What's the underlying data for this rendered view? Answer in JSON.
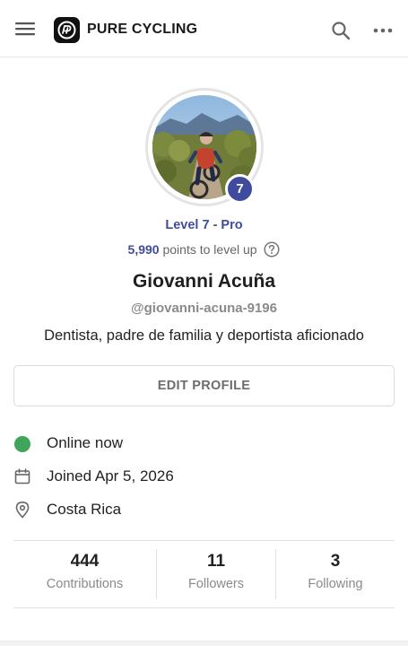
{
  "header": {
    "brand": "PURE CYCLING",
    "icons": [
      "hamburger-menu-icon",
      "pure-cycling-logo-icon",
      "search-icon",
      "more-options-icon"
    ]
  },
  "profile": {
    "level_badge": "7",
    "level_label": "Level 7 - Pro",
    "points": "5,990",
    "points_suffix": "points to level up",
    "name": "Giovanni Acuña",
    "handle": "@giovanni-acuna-9196",
    "bio": "Dentista, padre de familia y deportista aficionado",
    "edit_button": "EDIT PROFILE"
  },
  "info": {
    "status": "Online now",
    "joined": "Joined Apr 5, 2026",
    "location": "Costa Rica"
  },
  "stats": [
    {
      "value": "444",
      "label": "Contributions"
    },
    {
      "value": "11",
      "label": "Followers"
    },
    {
      "value": "3",
      "label": "Following"
    }
  ],
  "colors": {
    "accent": "#3f4c9d",
    "online": "#3ea55b",
    "muted": "#8a8a8a"
  }
}
